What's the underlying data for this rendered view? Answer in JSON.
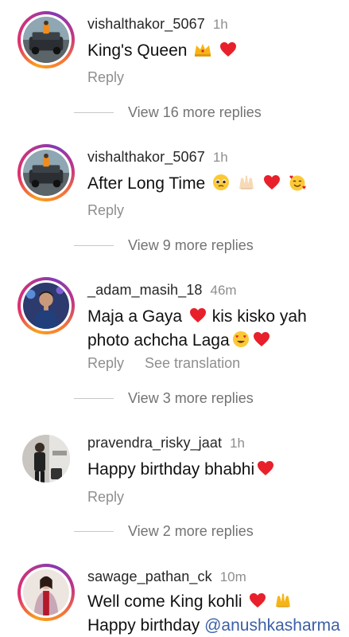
{
  "comments": [
    {
      "username": "vishalthakor_5067",
      "time": "1h",
      "text": "King's Queen",
      "emojis": [
        "crown-emoji",
        "heart-emoji"
      ],
      "reply": "Reply",
      "more": "View 16 more replies",
      "avatar": "car-photo-avatar"
    },
    {
      "username": "vishalthakor_5067",
      "time": "1h",
      "text": "After Long Time",
      "emojis": [
        "pleading-face-emoji",
        "raising-hands-emoji",
        "heart-emoji",
        "smiling-face-hearts-emoji"
      ],
      "reply": "Reply",
      "more": "View 9 more replies",
      "avatar": "car-photo-avatar"
    },
    {
      "username": "_adam_masih_18",
      "time": "46m",
      "text_line1": "Maja a Gaya",
      "text_line1_after": "kis kisko yah",
      "text_line2": "photo achcha Laga",
      "reply": "Reply",
      "translate": "See translation",
      "more": "View 3 more replies",
      "avatar": "man-photo-avatar"
    },
    {
      "username": "pravendra_risky_jaat",
      "time": "1h",
      "text": "Happy birthday bhabhi",
      "reply": "Reply",
      "more": "View 2 more replies",
      "avatar": "man-wall-photo-avatar"
    },
    {
      "username": "sawage_pathan_ck",
      "time": "10m",
      "text_line1": "Well come King kohli",
      "text_line2_prefix": "Happy birthday",
      "mention": "@anushkasharma",
      "avatar": "woman-photo-avatar"
    }
  ],
  "colors": {
    "heart": "#e8202b",
    "mention": "#3b5fa8",
    "muted": "#8e8e8e"
  }
}
